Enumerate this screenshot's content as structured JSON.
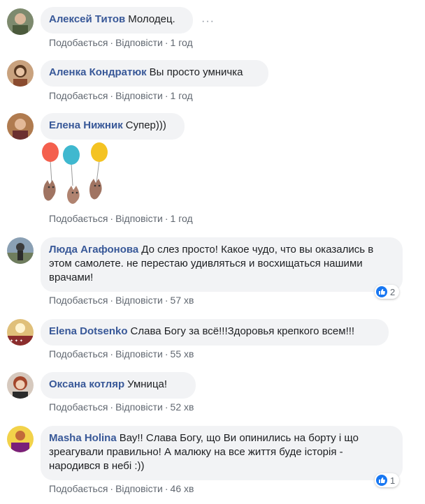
{
  "comments": [
    {
      "author": "Алексей Титов",
      "text": "Молодец.",
      "like": "Подобається",
      "reply": "Відповісти",
      "time": "1 год",
      "more_icon": "···"
    },
    {
      "author": "Аленка Кондратюк",
      "text": "Вы просто умничка",
      "like": "Подобається",
      "reply": "Відповісти",
      "time": "1 год"
    },
    {
      "author": "Елена Нижник",
      "text": "Супер)))",
      "like": "Подобається",
      "reply": "Відповісти",
      "time": "1 год"
    },
    {
      "author": "Люда Агафонова",
      "text": "До слез просто! Какое чудо, что вы оказались в этом самолете. не перестаю удивляться и восхищаться нашими врачами!",
      "like": "Подобається",
      "reply": "Відповісти",
      "time": "57 хв",
      "reactions": "2"
    },
    {
      "author": "Elena Dotsenko",
      "text": "Слава Богу за всё!!!Здоровья крепкого всем!!!",
      "like": "Подобається",
      "reply": "Відповісти",
      "time": "55 хв"
    },
    {
      "author": "Оксана котляр",
      "text": "Умница!",
      "like": "Подобається",
      "reply": "Відповісти",
      "time": "52 хв"
    },
    {
      "author": "Masha Holina",
      "text": "Вау!! Слава Богу, що Ви опинились на борту і що зреагували правильно! А малюку на все життя буде історія - народився в небі :))",
      "like": "Подобається",
      "reply": "Відповісти",
      "time": "46 хв",
      "reactions": "1"
    }
  ],
  "colors": {
    "link": "#385898",
    "bubble": "#f2f3f5",
    "meta": "#606770",
    "like_blue": "#1877f2"
  }
}
